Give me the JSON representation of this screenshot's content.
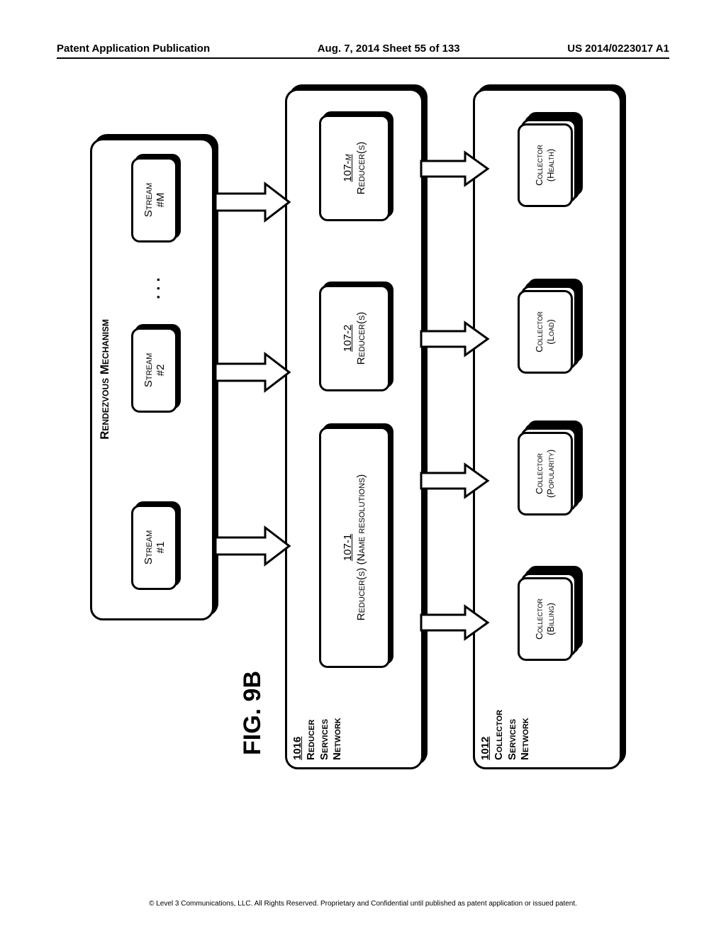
{
  "header": {
    "left": "Patent Application Publication",
    "center": "Aug. 7, 2014  Sheet 55 of 133",
    "right": "US 2014/0223017 A1"
  },
  "fig_label": "FIG. 9B",
  "rendezvous": {
    "title": "Rendezvous Mechanism",
    "streams": [
      {
        "line1": "Stream",
        "line2": "#1"
      },
      {
        "line1": "Stream",
        "line2": "#2"
      },
      {
        "line1": "Stream",
        "line2": "#M"
      }
    ],
    "ellipsis": ". . ."
  },
  "reducer_network": {
    "ref": "1016",
    "label_l1": "Reducer",
    "label_l2": "Services",
    "label_l3": "Network",
    "reducers": [
      {
        "id": "107-1",
        "label": "Reducer(s) (Name resolutions)"
      },
      {
        "id": "107-2",
        "label": "Reducer(s)"
      },
      {
        "id_prefix": "107-",
        "id_suffix": "m",
        "label": "Reducer(s)"
      }
    ]
  },
  "collector_network": {
    "ref": "1012",
    "label_l1": "Collector",
    "label_l2": "Services",
    "label_l3": "Network",
    "collectors": [
      {
        "line1": "Collector",
        "line2": "(Billing)"
      },
      {
        "line1": "Collector",
        "line2": "(Popularity)"
      },
      {
        "line1": "Collector",
        "line2": "(Load)"
      },
      {
        "line1": "Collector",
        "line2": "(Health)"
      }
    ]
  },
  "footer": "© Level 3 Communications, LLC.  All Rights Reserved.  Proprietary and Confidential until published as patent application or issued patent."
}
